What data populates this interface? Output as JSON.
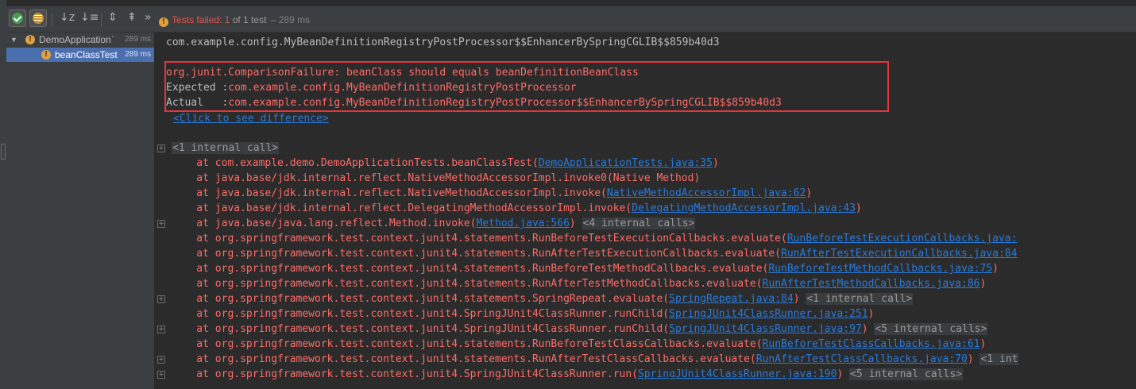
{
  "toolbar": {
    "buttons": [
      {
        "icon": "show-passed-icon"
      },
      {
        "icon": "show-ignored-icon"
      },
      {
        "icon": "sort-alphabetically-icon",
        "glyph": "↓z"
      },
      {
        "icon": "sort-by-duration-icon",
        "glyph": "↓≡"
      },
      {
        "icon": "expand-all-icon",
        "glyph": "⇕"
      },
      {
        "icon": "collapse-all-icon",
        "glyph": "⇞"
      },
      {
        "icon": "more-icon",
        "glyph": "»"
      }
    ],
    "status": {
      "failed_text": "Tests failed: 1",
      "count_text": " of 1 test",
      "duration": " – 289 ms"
    }
  },
  "tree": {
    "items": [
      {
        "label": "DemoApplication`",
        "time": "289 ms",
        "expanded": true
      },
      {
        "label": "beanClassTest",
        "time": "289 ms",
        "selected": true
      }
    ]
  },
  "console": {
    "header_line": "com.example.config.MyBeanDefinitionRegistryPostProcessor$$EnhancerBySpringCGLIB$$859b40d3",
    "failure": {
      "message": "org.junit.ComparisonFailure: beanClass should equals beanDefinitionBeanClass",
      "expected_label": "Expected :",
      "expected_value": "com.example.config.MyBeanDefinitionRegistryPostProcessor",
      "actual_label": "Actual   :",
      "actual_value": "com.example.config.MyBeanDefinitionRegistryPostProcessor$$EnhancerBySpringCGLIB$$859b40d3"
    },
    "diff_link": "<Click to see difference>",
    "internal_call_first": "<1 internal call>",
    "stack": [
      {
        "text": "    at com.example.demo.DemoApplicationTests.beanClassTest(",
        "link": "DemoApplicationTests.java:35",
        "close": ")",
        "fold": ""
      },
      {
        "text": "    at java.base/jdk.internal.reflect.NativeMethodAccessorImpl.invoke0(Native Method)",
        "link": "",
        "close": "",
        "fold": ""
      },
      {
        "text": "    at java.base/jdk.internal.reflect.NativeMethodAccessorImpl.invoke(",
        "link": "NativeMethodAccessorImpl.java:62",
        "close": ")",
        "fold": ""
      },
      {
        "text": "    at java.base/jdk.internal.reflect.DelegatingMethodAccessorImpl.invoke(",
        "link": "DelegatingMethodAccessorImpl.java:43",
        "close": ")",
        "fold": ""
      },
      {
        "text": "    at java.base/java.lang.reflect.Method.invoke(",
        "link": "Method.java:566",
        "close": ")",
        "fold": "<4 internal calls>"
      },
      {
        "text": "    at org.springframework.test.context.junit4.statements.RunBeforeTestExecutionCallbacks.evaluate(",
        "link": "RunBeforeTestExecutionCallbacks.java:",
        "close": "",
        "fold": ""
      },
      {
        "text": "    at org.springframework.test.context.junit4.statements.RunAfterTestExecutionCallbacks.evaluate(",
        "link": "RunAfterTestExecutionCallbacks.java:84",
        "close": "",
        "fold": ""
      },
      {
        "text": "    at org.springframework.test.context.junit4.statements.RunBeforeTestMethodCallbacks.evaluate(",
        "link": "RunBeforeTestMethodCallbacks.java:75",
        "close": ")",
        "fold": ""
      },
      {
        "text": "    at org.springframework.test.context.junit4.statements.RunAfterTestMethodCallbacks.evaluate(",
        "link": "RunAfterTestMethodCallbacks.java:86",
        "close": ")",
        "fold": ""
      },
      {
        "text": "    at org.springframework.test.context.junit4.statements.SpringRepeat.evaluate(",
        "link": "SpringRepeat.java:84",
        "close": ")",
        "fold": "<1 internal call>"
      },
      {
        "text": "    at org.springframework.test.context.junit4.SpringJUnit4ClassRunner.runChild(",
        "link": "SpringJUnit4ClassRunner.java:251",
        "close": ")",
        "fold": ""
      },
      {
        "text": "    at org.springframework.test.context.junit4.SpringJUnit4ClassRunner.runChild(",
        "link": "SpringJUnit4ClassRunner.java:97",
        "close": ")",
        "fold": "<5 internal calls>"
      },
      {
        "text": "    at org.springframework.test.context.junit4.statements.RunBeforeTestClassCallbacks.evaluate(",
        "link": "RunBeforeTestClassCallbacks.java:61",
        "close": ")",
        "fold": ""
      },
      {
        "text": "    at org.springframework.test.context.junit4.statements.RunAfterTestClassCallbacks.evaluate(",
        "link": "RunAfterTestClassCallbacks.java:70",
        "close": ")",
        "fold": "<1 int"
      },
      {
        "text": "    at org.springframework.test.context.junit4.SpringJUnit4ClassRunner.run(",
        "link": "SpringJUnit4ClassRunner.java:190",
        "close": ")",
        "fold": "<5 internal calls>"
      }
    ]
  }
}
